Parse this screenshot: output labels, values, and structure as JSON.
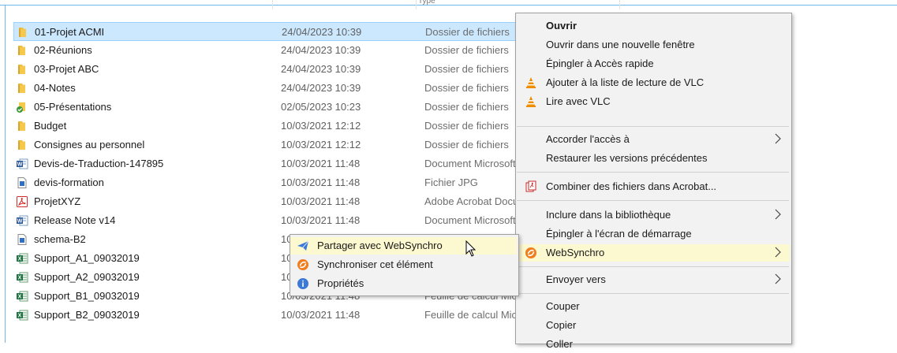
{
  "header": {
    "type_column_fragment": "Type"
  },
  "files": [
    {
      "icon": "folder-icon",
      "name": "01-Projet ACMI",
      "date": "24/04/2023 10:39",
      "type": "Dossier de fichiers"
    },
    {
      "icon": "folder-icon",
      "name": "02-Réunions",
      "date": "24/04/2023 10:39",
      "type": "Dossier de fichiers"
    },
    {
      "icon": "folder-icon",
      "name": "03-Projet ABC",
      "date": "24/04/2023 10:39",
      "type": "Dossier de fichiers"
    },
    {
      "icon": "folder-icon",
      "name": "04-Notes",
      "date": "24/04/2023 10:39",
      "type": "Dossier de fichiers"
    },
    {
      "icon": "synced-folder-icon",
      "name": "05-Présentations",
      "date": "02/05/2023 10:23",
      "type": "Dossier de fichiers"
    },
    {
      "icon": "folder-icon",
      "name": "Budget",
      "date": "10/03/2021 12:12",
      "type": "Dossier de fichiers"
    },
    {
      "icon": "folder-icon",
      "name": "Consignes au personnel",
      "date": "10/03/2021 12:12",
      "type": "Dossier de fichiers"
    },
    {
      "icon": "word-document-icon",
      "name": "Devis-de-Traduction-147895",
      "date": "10/03/2021 11:48",
      "type": "Document Microsoft Word"
    },
    {
      "icon": "image-file-icon",
      "name": "devis-formation",
      "date": "10/03/2021 11:48",
      "type": "Fichier JPG"
    },
    {
      "icon": "pdf-icon",
      "name": "ProjetXYZ",
      "date": "10/03/2021 11:48",
      "type": "Adobe Acrobat Document"
    },
    {
      "icon": "word-document-icon",
      "name": "Release Note v14",
      "date": "10/03/2021 11:48",
      "type": "Document Microsoft Word"
    },
    {
      "icon": "image-file-icon",
      "name": "schema-B2",
      "date": "10/",
      "type": ""
    },
    {
      "icon": "excel-icon",
      "name": "Support_A1_09032019",
      "date": "10/",
      "type": ""
    },
    {
      "icon": "excel-icon",
      "name": "Support_A2_09032019",
      "date": "10/",
      "type": ""
    },
    {
      "icon": "excel-icon",
      "name": "Support_B1_09032019",
      "date": "10/03/2021 11:48",
      "type": "Feuille de calcul Microsoft Excel"
    },
    {
      "icon": "excel-icon",
      "name": "Support_B2_09032019",
      "date": "10/03/2021 11:48",
      "type": "Feuille de calcul Microsoft Excel"
    }
  ],
  "context_menu": {
    "items": [
      {
        "label": "Ouvrir",
        "icon": "",
        "bold": true
      },
      {
        "label": "Ouvrir dans une nouvelle fenêtre",
        "icon": ""
      },
      {
        "label": "Épingler à Accès rapide",
        "icon": ""
      },
      {
        "label": "Ajouter à la liste de lecture de VLC",
        "icon": "vlc-icon"
      },
      {
        "label": "Lire avec VLC",
        "icon": "vlc-icon"
      },
      {
        "label": "Accorder l'accès à",
        "icon": "",
        "submenu": true
      },
      {
        "label": "Restaurer les versions précédentes",
        "icon": ""
      },
      {
        "label": "Combiner des fichiers dans Acrobat...",
        "icon": "acrobat-combine-icon"
      },
      {
        "label": "Inclure dans la bibliothèque",
        "icon": "",
        "submenu": true
      },
      {
        "label": "Épingler à l'écran de démarrage",
        "icon": ""
      },
      {
        "label": "WebSynchro",
        "icon": "websynchro-icon",
        "submenu": true,
        "highlighted": true
      },
      {
        "label": "Envoyer vers",
        "icon": "",
        "submenu": true
      },
      {
        "label": "Couper",
        "icon": ""
      },
      {
        "label": "Copier",
        "icon": ""
      },
      {
        "label": "Coller",
        "icon": ""
      }
    ]
  },
  "submenu": {
    "items": [
      {
        "label": "Partager avec WebSynchro",
        "icon": "send-icon",
        "highlighted": true
      },
      {
        "label": "Synchroniser cet élément",
        "icon": "websynchro-icon"
      },
      {
        "label": "Propriétés",
        "icon": "info-icon"
      }
    ]
  },
  "colors": {
    "selection": "#cce8ff",
    "menu_highlight": "#fcf8cf",
    "folder": "#e8b93a",
    "vlc": "#f08c00",
    "websynchro": "#f07d1e",
    "info": "#3b78d8"
  }
}
